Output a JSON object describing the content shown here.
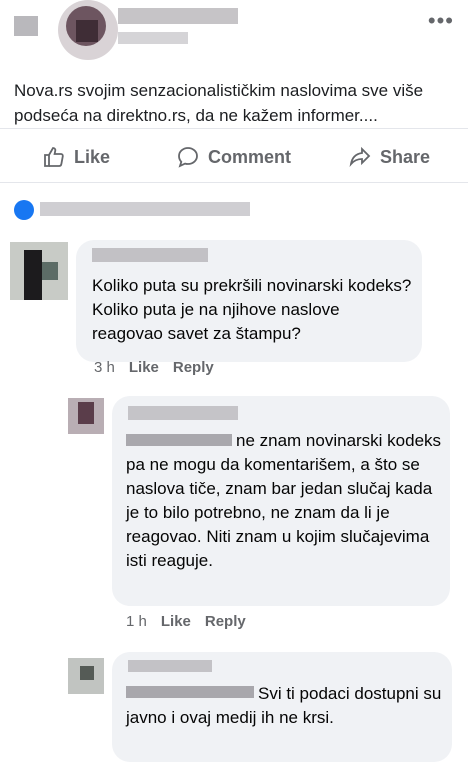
{
  "post": {
    "text": "Nova.rs svojim senzacionalističkim naslovima sve više podseća na direktno.rs, da ne kažem informer....",
    "more_label": "•••"
  },
  "actions": {
    "like": "Like",
    "comment": "Comment",
    "share": "Share"
  },
  "comments": [
    {
      "text": "Koliko puta su prekršili novinarski kodeks? Koliko puta je na njihove naslove reagovao savet za štampu?",
      "time": "3 h",
      "like": "Like",
      "reply": "Reply"
    },
    {
      "text": "ne znam novinarski kodeks pa ne mogu da komentarišem, a što se naslova tiče, znam bar jedan slučaj kada je to bilo potrebno, ne znam da li je reagovao. Niti znam u kojim slučajevima isti reaguje.",
      "time": "1 h",
      "like": "Like",
      "reply": "Reply"
    },
    {
      "text": "Svi ti podaci dostupni su javno i ovaj medij ih ne krsi."
    }
  ],
  "colors": {
    "accent": "#1877f2",
    "muted": "#65676b",
    "bubble": "#f0f2f5"
  }
}
